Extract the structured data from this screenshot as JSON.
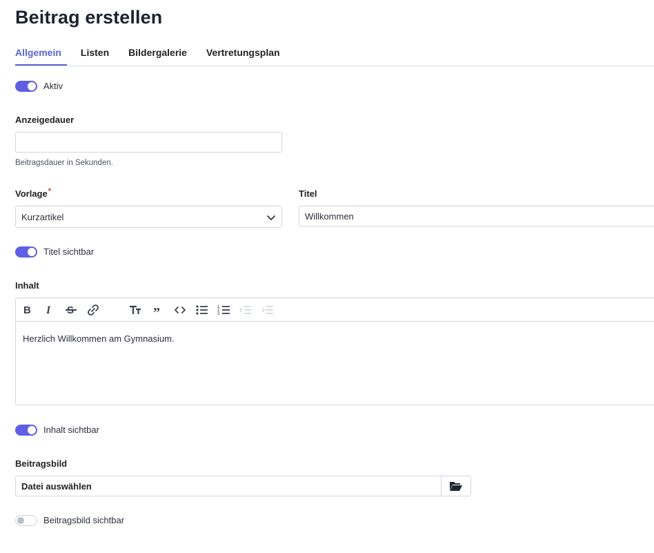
{
  "page": {
    "title": "Beitrag erstellen"
  },
  "tabs": [
    "Allgemein",
    "Listen",
    "Bildergalerie",
    "Vertretungsplan"
  ],
  "toggles": {
    "aktiv": {
      "label": "Aktiv",
      "on": true
    },
    "titel_sichtbar": {
      "label": "Titel sichtbar",
      "on": true
    },
    "inhalt_sichtbar": {
      "label": "Inhalt sichtbar",
      "on": true
    },
    "beitragsbild_sichtbar": {
      "label": "Beitragsbild sichtbar",
      "on": false
    }
  },
  "anzeigedauer": {
    "label": "Anzeigedauer",
    "value": "",
    "hint": "Beitragsdauer in Sekunden."
  },
  "vorlage": {
    "label": "Vorlage",
    "required_marker": "*",
    "value": "Kurzartikel"
  },
  "titel": {
    "label": "Titel",
    "value": "Willkommen"
  },
  "inhalt": {
    "label": "Inhalt",
    "toolbar": [
      "bold-icon",
      "italic-icon",
      "strikethrough-icon",
      "link-icon",
      "heading-icon",
      "quote-icon",
      "code-icon",
      "bullet-list-icon",
      "numbered-list-icon",
      "outdent-icon",
      "indent-icon"
    ],
    "text": "Herzlich Willkommen am Gymnasium."
  },
  "beitragsbild": {
    "label": "Beitragsbild",
    "value": "Datei auswählen",
    "button_icon": "folder-open-icon"
  },
  "colors": {
    "accent": "#5a63d8",
    "toggle_on": "#5e5fe4",
    "border": "#cfd6e2",
    "required": "#e03131"
  }
}
